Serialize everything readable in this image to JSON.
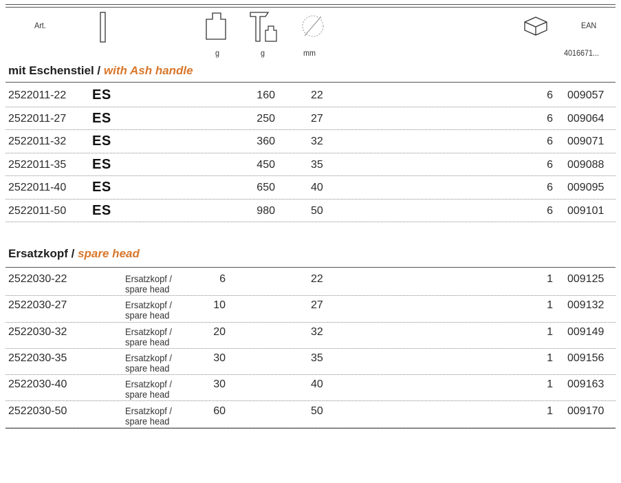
{
  "header": {
    "art_label": "Art.",
    "ean_label": "EAN",
    "unit_g1": "g",
    "unit_g2": "g",
    "unit_mm": "mm",
    "ean_prefix": "4016671..."
  },
  "icons": {
    "length": "handle-length-icon",
    "weight": "weight-icon",
    "hammer_weight": "hammer-weight-icon",
    "diameter": "diameter-icon",
    "package": "package-box-icon"
  },
  "sections": [
    {
      "title_de": "mit Eschenstiel /",
      "title_en": "with Ash handle",
      "rows": [
        {
          "art": "2522011-22",
          "mark": "ES",
          "w_total": "160",
          "diameter": "22",
          "pack": "6",
          "ean": "009057"
        },
        {
          "art": "2522011-27",
          "mark": "ES",
          "w_total": "250",
          "diameter": "27",
          "pack": "6",
          "ean": "009064"
        },
        {
          "art": "2522011-32",
          "mark": "ES",
          "w_total": "360",
          "diameter": "32",
          "pack": "6",
          "ean": "009071"
        },
        {
          "art": "2522011-35",
          "mark": "ES",
          "w_total": "450",
          "diameter": "35",
          "pack": "6",
          "ean": "009088"
        },
        {
          "art": "2522011-40",
          "mark": "ES",
          "w_total": "650",
          "diameter": "40",
          "pack": "6",
          "ean": "009095"
        },
        {
          "art": "2522011-50",
          "mark": "ES",
          "w_total": "980",
          "diameter": "50",
          "pack": "6",
          "ean": "009101"
        }
      ]
    },
    {
      "title_de": "Ersatzkopf /",
      "title_en": "spare head",
      "rows": [
        {
          "art": "2522030-22",
          "desc1": "Ersatzkopf /",
          "desc2": "spare head",
          "w_head": "6",
          "diameter": "22",
          "pack": "1",
          "ean": "009125"
        },
        {
          "art": "2522030-27",
          "desc1": "Ersatzkopf /",
          "desc2": "spare head",
          "w_head": "10",
          "diameter": "27",
          "pack": "1",
          "ean": "009132"
        },
        {
          "art": "2522030-32",
          "desc1": "Ersatzkopf /",
          "desc2": "spare head",
          "w_head": "20",
          "diameter": "32",
          "pack": "1",
          "ean": "009149"
        },
        {
          "art": "2522030-35",
          "desc1": "Ersatzkopf /",
          "desc2": "spare head",
          "w_head": "30",
          "diameter": "35",
          "pack": "1",
          "ean": "009156"
        },
        {
          "art": "2522030-40",
          "desc1": "Ersatzkopf /",
          "desc2": "spare head",
          "w_head": "30",
          "diameter": "40",
          "pack": "1",
          "ean": "009163"
        },
        {
          "art": "2522030-50",
          "desc1": "Ersatzkopf /",
          "desc2": "spare head",
          "w_head": "60",
          "diameter": "50",
          "pack": "1",
          "ean": "009170"
        }
      ]
    }
  ]
}
